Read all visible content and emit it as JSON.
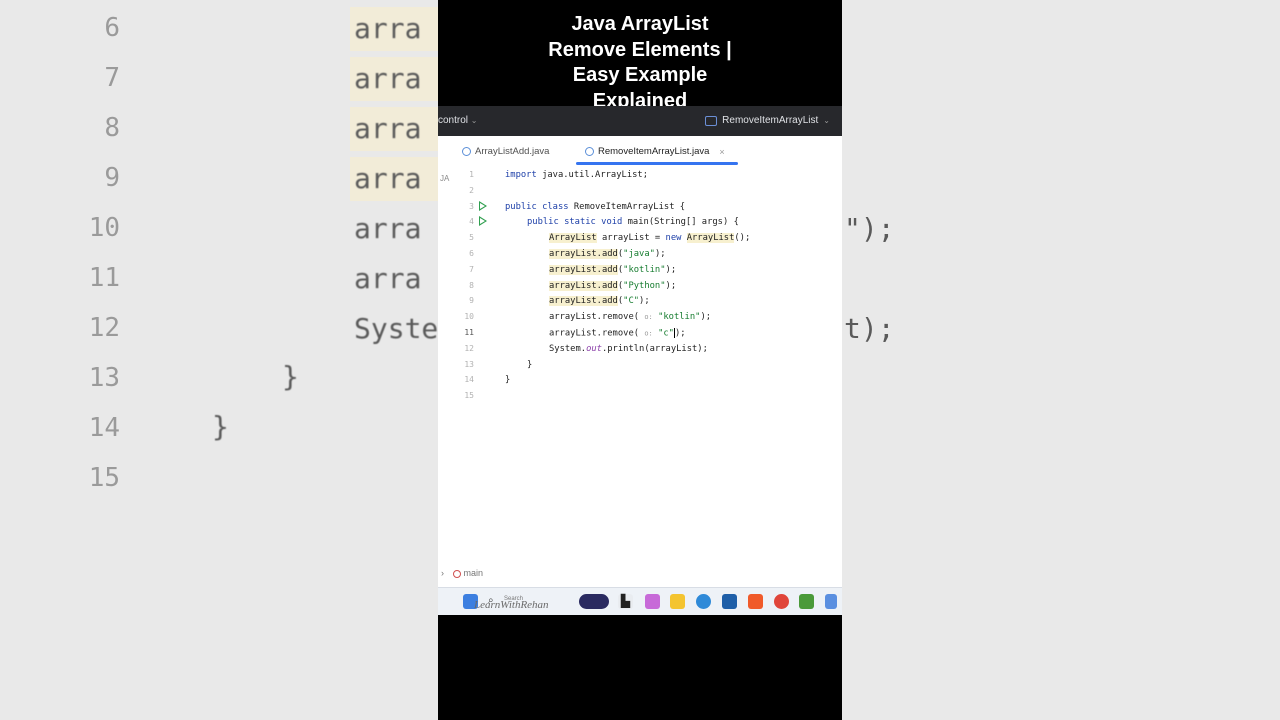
{
  "video_title": "Java ArrayList\nRemove Elements |\nEasy Example\nExplained",
  "toolbar": {
    "project": "control",
    "run_config": "RemoveItemArrayList"
  },
  "tabs": [
    {
      "label": "ArrayListAdd.java"
    },
    {
      "label": "RemoveItemArrayList.java",
      "active": true
    }
  ],
  "gutter_file_label": "JA",
  "code": {
    "line_numbers": [
      "1",
      "2",
      "3",
      "4",
      "5",
      "6",
      "7",
      "8",
      "9",
      "10",
      "11",
      "12",
      "13",
      "14",
      "15"
    ],
    "l1_kw": "import",
    "l1_rest": " java.util.ArrayList;",
    "l3_kw": "public class",
    "l3_rest": " RemoveItemArrayList {",
    "l4_kw": "public static void",
    "l4_rest": " main(String[] args) {",
    "l5_a": "ArrayList",
    "l5_b": " arrayList = ",
    "l5_kw": "new",
    "l5_c": " ",
    "l5_d": "ArrayList",
    "l5_e": "();",
    "add_var": "arrayList.add",
    "l6_str": "\"java\"",
    "l7_str": "\"kotlin\"",
    "l8_str": "\"Python\"",
    "l9_str": "\"C\"",
    "remove_call": "arrayList.remove(",
    "hint": "o:",
    "l10_str": "\"kotlin\"",
    "l11_str": "\"c\"",
    "l12_a": "System.",
    "l12_out": "out",
    "l12_b": ".println(arrayList);",
    "close_brace": "}"
  },
  "status_bar": {
    "breadcrumb": "main"
  },
  "taskbar": {
    "search_label": "Search",
    "watermark": "LearnWithRehan"
  },
  "background": {
    "line_numbers": [
      "6",
      "7",
      "8",
      "9",
      "10",
      "11",
      "12",
      "13",
      "14",
      "15"
    ],
    "code_fragments": [
      "arra",
      "arra",
      "arra",
      "arra",
      "arra",
      "arra",
      "Syste",
      "}",
      "}"
    ],
    "right_fragments": [
      "\");",
      "t);"
    ]
  },
  "colors": {
    "keyword": "#1d3fa8",
    "string": "#167c2f",
    "run_icon": "#2f9f4f",
    "active_tab": "#3574f0"
  }
}
